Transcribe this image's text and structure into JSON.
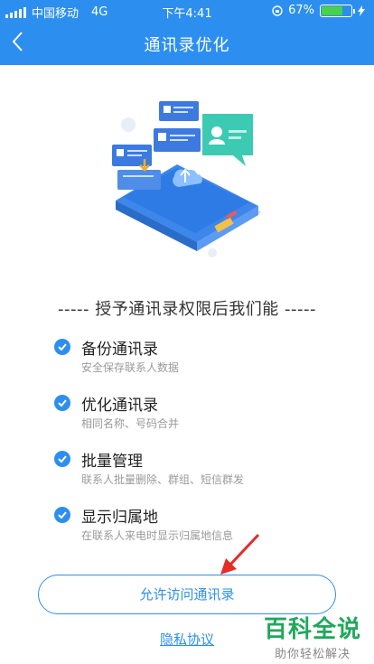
{
  "status": {
    "carrier": "中国移动",
    "network": "4G",
    "time": "下午4:41",
    "battery": "67%",
    "battery_level": 0.67
  },
  "nav": {
    "title": "通讯录优化"
  },
  "section_title": "----- 授予通讯录权限后我们能 -----",
  "features": [
    {
      "title": "备份通讯录",
      "subtitle": "安全保存联系人数据"
    },
    {
      "title": "优化通讯录",
      "subtitle": "相同名称、号码合并"
    },
    {
      "title": "批量管理",
      "subtitle": "联系人批量删除、群组、短信群发"
    },
    {
      "title": "显示归属地",
      "subtitle": "在联系人来电时显示归属地信息"
    }
  ],
  "allow_button": "允许访问通讯录",
  "privacy_link": "隐私协议",
  "watermark": {
    "main": "百科全说",
    "sub": "助你轻松解决"
  },
  "colors": {
    "primary": "#2c8ff0",
    "battery": "#48d14a",
    "watermark": "#1fa85a",
    "arrow": "#e52d27"
  },
  "icons": [
    "signal-icon",
    "back-chevron-icon",
    "check-icon",
    "rotation-lock-icon",
    "charging-icon"
  ]
}
